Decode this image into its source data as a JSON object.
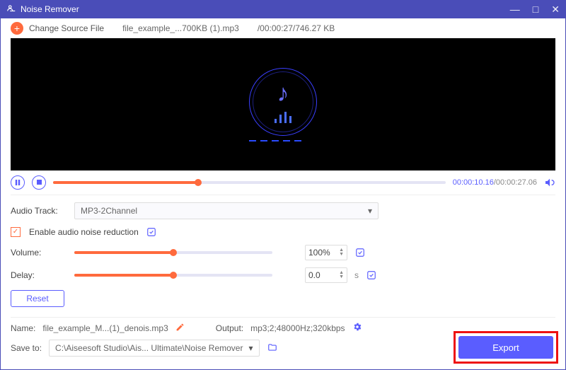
{
  "title": "Noise Remover",
  "subbar": {
    "change_source": "Change Source File",
    "filename": "file_example_...700KB (1).mp3",
    "info": "/00:00:27/746.27 KB"
  },
  "play": {
    "current": "00:00:10.16",
    "total": "/00:00:27.06"
  },
  "track": {
    "label": "Audio Track:",
    "value": "MP3-2Channel"
  },
  "noise": {
    "label": "Enable audio noise reduction"
  },
  "volume": {
    "label": "Volume:",
    "value": "100%"
  },
  "delay": {
    "label": "Delay:",
    "value": "0.0",
    "unit": "s"
  },
  "reset": "Reset",
  "name": {
    "label": "Name:",
    "value": "file_example_M...(1)_denois.mp3"
  },
  "output": {
    "label": "Output:",
    "value": "mp3;2;48000Hz;320kbps"
  },
  "save": {
    "label": "Save to:",
    "value": "C:\\Aiseesoft Studio\\Ais... Ultimate\\Noise Remover"
  },
  "export": "Export"
}
